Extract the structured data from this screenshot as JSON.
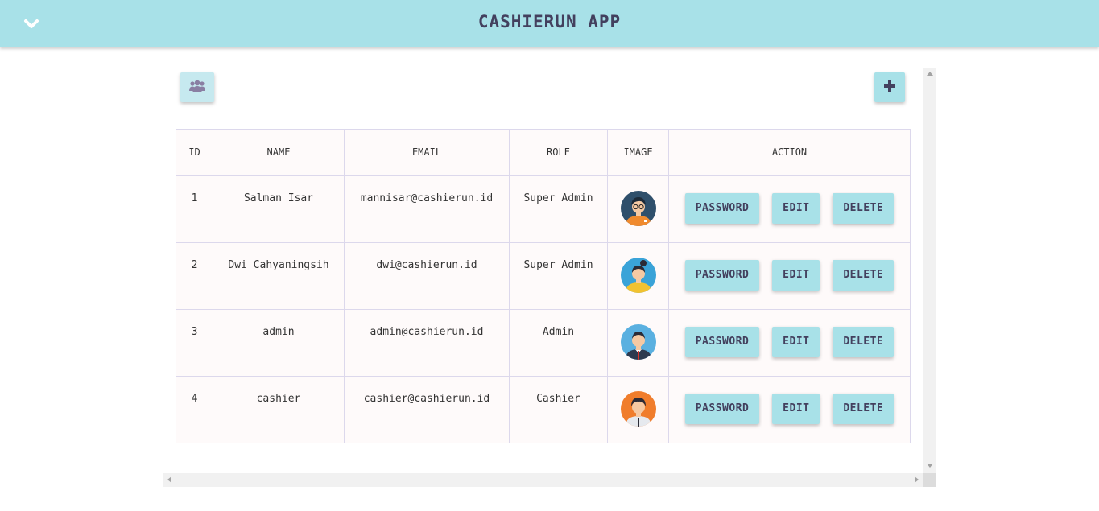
{
  "app": {
    "title": "CASHIERUN APP"
  },
  "table": {
    "headers": [
      "ID",
      "NAME",
      "EMAIL",
      "ROLE",
      "IMAGE",
      "ACTION"
    ],
    "rows": [
      {
        "id": "1",
        "name": "Salman Isar",
        "email": "mannisar@cashierun.id",
        "role": "Super Admin",
        "avatar": "man-glasses-avatar"
      },
      {
        "id": "2",
        "name": "Dwi Cahyaningsih",
        "email": "dwi@cashierun.id",
        "role": "Super Admin",
        "avatar": "woman-avatar"
      },
      {
        "id": "3",
        "name": "admin",
        "email": "admin@cashierun.id",
        "role": "Admin",
        "avatar": "man-suit-avatar"
      },
      {
        "id": "4",
        "name": "cashier",
        "email": "cashier@cashierun.id",
        "role": "Cashier",
        "avatar": "cashier-avatar"
      }
    ]
  },
  "actions": {
    "password": "PASSWORD",
    "edit": "EDIT",
    "delete": "DELETE"
  },
  "icons": {
    "toggle": "chevron-down-icon",
    "users": "users-icon",
    "add": "plus-icon"
  },
  "colors": {
    "header_bg": "#a8e1e8",
    "title": "#43405e",
    "button_bg": "#a8e1e8",
    "table_bg": "#fefafa"
  }
}
